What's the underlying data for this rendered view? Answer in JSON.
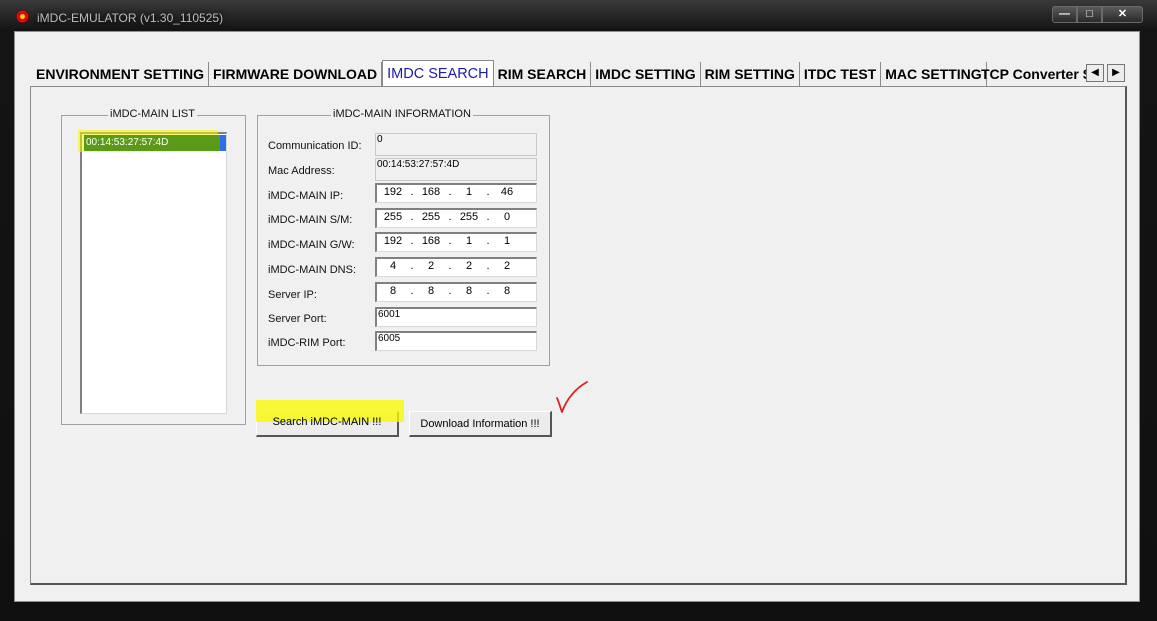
{
  "window": {
    "title": "iMDC-EMULATOR (v1.30_110525)",
    "min_glyph": "—",
    "max_glyph": "□",
    "close_glyph": "✕"
  },
  "tabs": [
    {
      "label": "ENVIRONMENT SETTING",
      "active": false
    },
    {
      "label": "FIRMWARE DOWNLOAD",
      "active": false
    },
    {
      "label": "IMDC SEARCH",
      "active": true
    },
    {
      "label": "RIM SEARCH",
      "active": false
    },
    {
      "label": "IMDC SETTING",
      "active": false
    },
    {
      "label": "RIM SETTING",
      "active": false
    },
    {
      "label": "ITDC TEST",
      "active": false
    },
    {
      "label": "MAC SETTING",
      "active": false
    },
    {
      "label": "TCP Converter Se",
      "active": false
    }
  ],
  "tab_scroll": {
    "left": "◀",
    "right": "▶"
  },
  "list": {
    "title": "iMDC-MAIN LIST",
    "items": [
      "00:14:53:27:57:4D"
    ]
  },
  "info": {
    "title": "iMDC-MAIN INFORMATION",
    "communication_id": {
      "label": "Communication ID:",
      "value": "0"
    },
    "mac_address": {
      "label": "Mac Address:",
      "value": "00:14:53:27:57:4D"
    },
    "ip": {
      "label": "iMDC-MAIN IP:",
      "octets": [
        "192",
        "168",
        "1",
        "46"
      ]
    },
    "subnet": {
      "label": "iMDC-MAIN S/M:",
      "octets": [
        "255",
        "255",
        "255",
        "0"
      ]
    },
    "gateway": {
      "label": "iMDC-MAIN G/W:",
      "octets": [
        "192",
        "168",
        "1",
        "1"
      ]
    },
    "dns": {
      "label": "iMDC-MAIN DNS:",
      "octets": [
        "4",
        "2",
        "2",
        "2"
      ]
    },
    "server_ip": {
      "label": "Server IP:",
      "octets": [
        "8",
        "8",
        "8",
        "8"
      ]
    },
    "server_port": {
      "label": "Server Port:",
      "value": "6001"
    },
    "rim_port": {
      "label": "iMDC-RIM Port:",
      "value": "6005"
    }
  },
  "buttons": {
    "search": "Search iMDC-MAIN !!!",
    "download": "Download Information !!!"
  },
  "colors": {
    "highlight": "#f5f500",
    "list_selection": "#5b9a16",
    "active_tab_text": "#1c1ca8",
    "check_mark": "#e02020"
  }
}
